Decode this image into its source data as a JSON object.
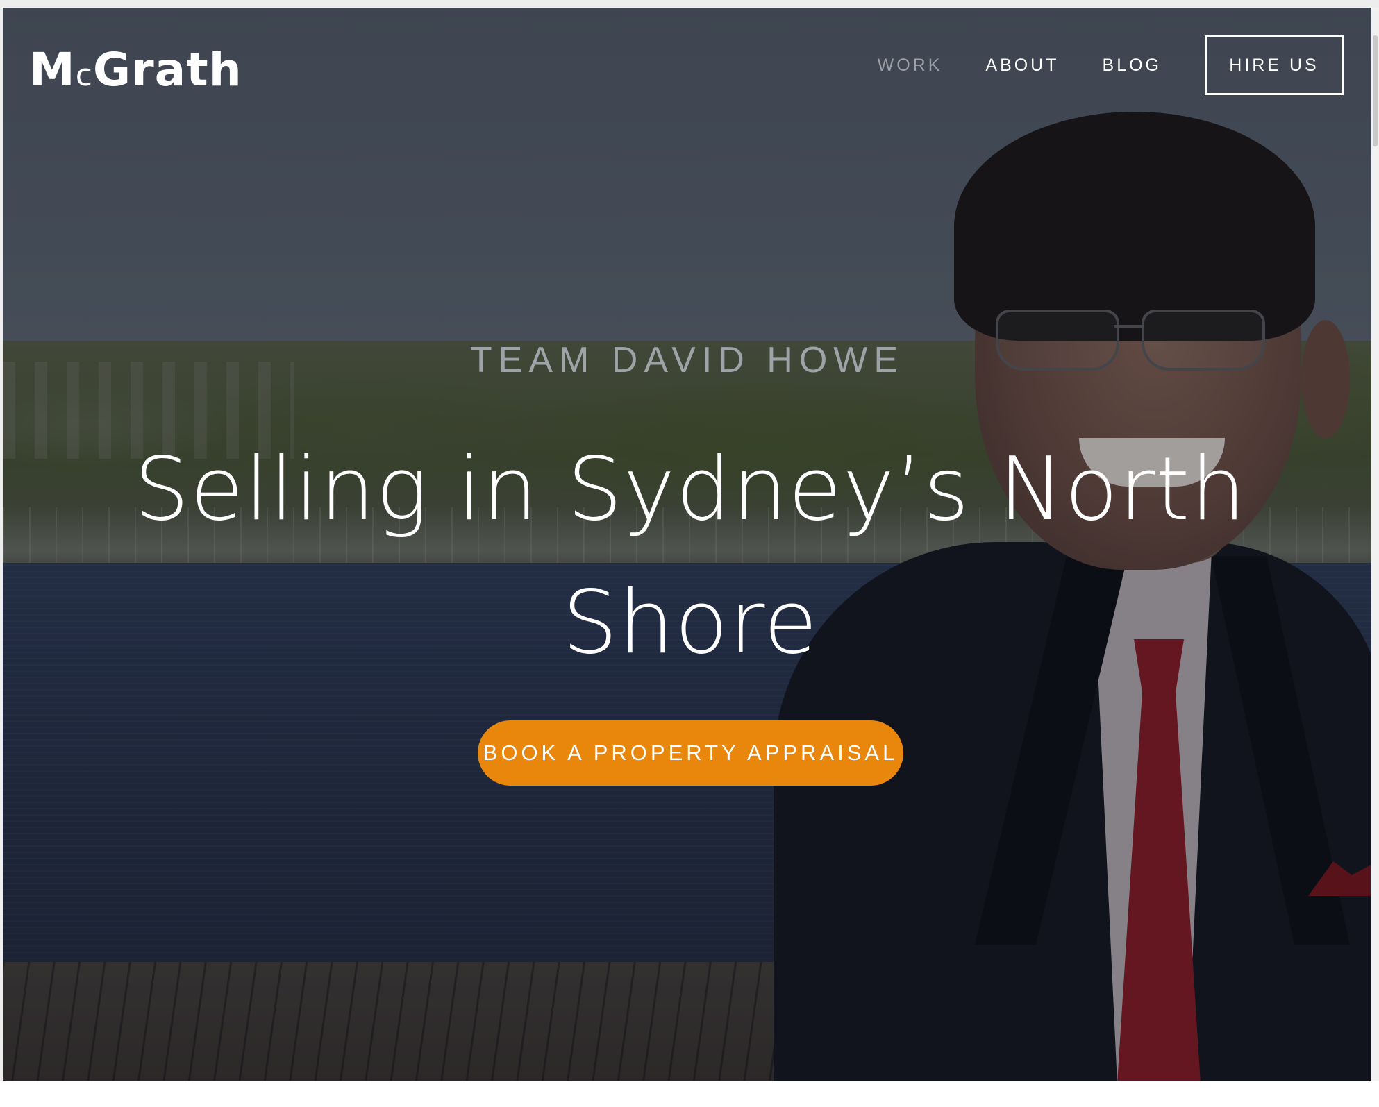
{
  "brand": {
    "logo_text_m": "M",
    "logo_text_c": "c",
    "logo_text_rest": "Grath"
  },
  "nav": {
    "items": [
      {
        "label": "WORK",
        "active": true
      },
      {
        "label": "ABOUT",
        "active": false
      },
      {
        "label": "BLOG",
        "active": false
      }
    ],
    "cta_label": "HIRE US"
  },
  "hero": {
    "eyebrow": "TEAM DAVID HOWE",
    "headline": "Selling in Sydney’s North Shore",
    "cta_label": "BOOK A PROPERTY APPRAISAL"
  },
  "colors": {
    "accent": "#e9860c",
    "nav_active": "#9aa0a6",
    "text_light": "#ffffff"
  }
}
